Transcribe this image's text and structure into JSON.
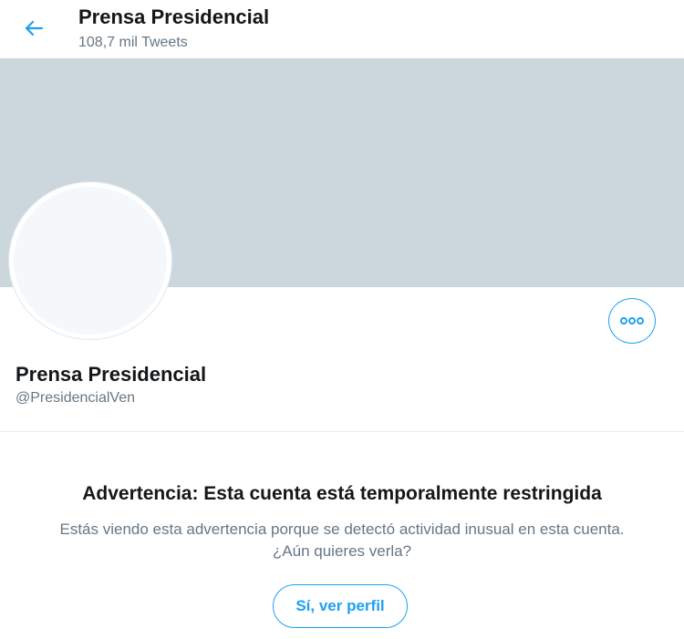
{
  "header": {
    "title": "Prensa Presidencial",
    "subtitle": "108,7 mil Tweets"
  },
  "profile": {
    "name": "Prensa Presidencial",
    "handle": "@PresidencialVen"
  },
  "warning": {
    "title": "Advertencia: Esta cuenta está temporalmente restringida",
    "text_line1": "Estás viendo esta advertencia porque se detectó actividad inusual en esta cuenta.",
    "text_line2": "¿Aún quieres verla?",
    "button_label": "Sí, ver perfil"
  },
  "icons": {
    "back": "back-arrow-icon",
    "more": "more-options-icon"
  },
  "colors": {
    "accent": "#1da1f2",
    "banner": "#ccd6dd",
    "text_primary": "#14171a",
    "text_secondary": "#657786"
  }
}
